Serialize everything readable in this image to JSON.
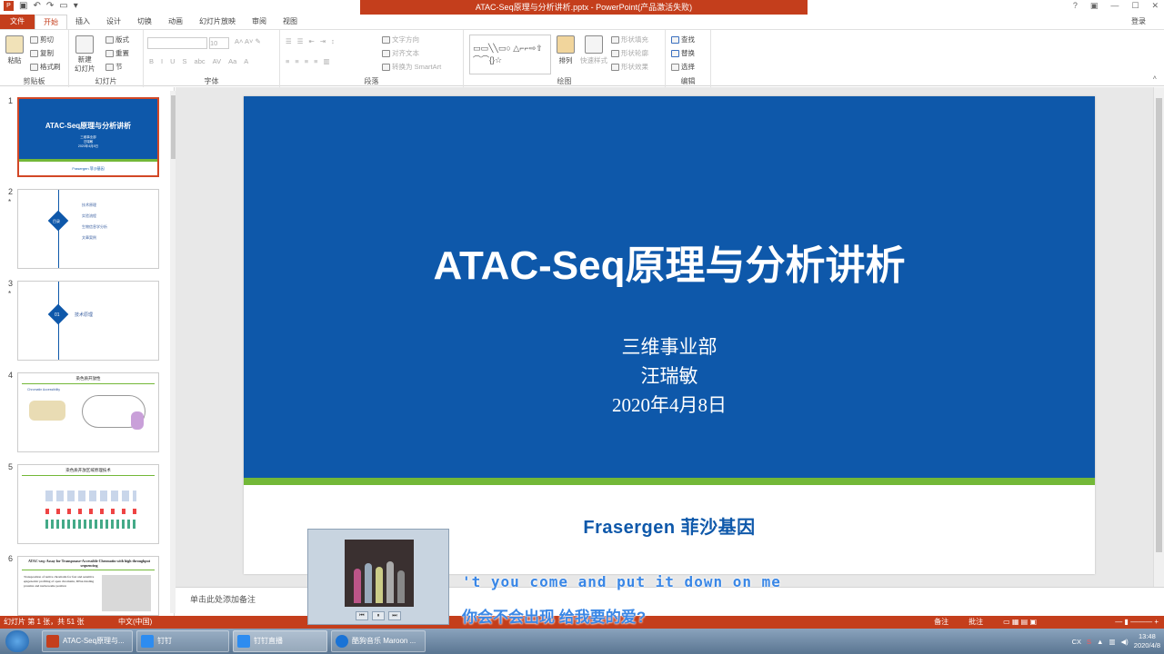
{
  "window": {
    "title": "ATAC-Seq原理与分析讲析.pptx - PowerPoint(产品激活失败)",
    "help": "?",
    "login": "登录"
  },
  "tabs": [
    "文件",
    "开始",
    "插入",
    "设计",
    "切换",
    "动画",
    "幻灯片放映",
    "审阅",
    "视图"
  ],
  "ribbon": {
    "clipboard": {
      "label": "剪贴板",
      "paste": "粘贴",
      "cut": "剪切",
      "copy": "复制",
      "format_painter": "格式刷"
    },
    "slides": {
      "label": "幻灯片",
      "new_slide": "新建\n幻灯片",
      "layout": "版式",
      "reset": "重置",
      "section": "节"
    },
    "font": {
      "label": "字体",
      "size": "10"
    },
    "paragraph": {
      "label": "段落",
      "text_direction": "文字方向",
      "align_text": "对齐文本",
      "smartart": "转换为 SmartArt"
    },
    "drawing": {
      "label": "绘图",
      "arrange": "排列",
      "quick_styles": "快速样式",
      "shape_fill": "形状填充",
      "shape_outline": "形状轮廓",
      "shape_effects": "形状效果"
    },
    "editing": {
      "label": "编辑",
      "find": "查找",
      "replace": "替换",
      "select": "选择"
    }
  },
  "thumbnails": [
    {
      "num": "1",
      "title": "ATAC-Seq原理与分析讲析",
      "lines": [
        "三维事业部",
        "汪瑞敏",
        "2020年4月8日"
      ],
      "logo": "Frasergen 菲沙基因"
    },
    {
      "num": "2",
      "star": "*",
      "heading": "目录",
      "items": [
        "技术原理",
        "实验流程",
        "生物信息学分析",
        "文章案例"
      ]
    },
    {
      "num": "3",
      "star": "*",
      "badge": "01",
      "heading": "技术原理"
    },
    {
      "num": "4",
      "heading": "染色质开放性",
      "sub": "Chromatin Accessibility"
    },
    {
      "num": "5",
      "heading": "染色质开放区域原理技术"
    },
    {
      "num": "6",
      "heading": "ATAC-seq: Assay for Transposase-Accessible Chromatin with high throughput sequencing",
      "body": "Transposition of native chromatin for fast and sensitive epigenomic profiling of open chromatin, DNA-binding proteins and nucleosome position"
    }
  ],
  "slide": {
    "title": "ATAC-Seq原理与分析讲析",
    "dept": "三维事业部",
    "author": "汪瑞敏",
    "date": "2020年4月8日",
    "logo": "Frasergen 菲沙基因"
  },
  "notes_placeholder": "单击此处添加备注",
  "status": {
    "slide_info": "幻灯片 第 1 张，共 51 张",
    "language": "中文(中国)",
    "notes": "备注",
    "comments": "批注"
  },
  "taskbar": {
    "tasks": [
      "ATAC-Seq原理与...",
      "钉钉",
      "钉钉直播",
      "酷狗音乐 Maroon ..."
    ],
    "ime": "CX",
    "time": "13:48",
    "date": "2020/4/8"
  },
  "lyrics": {
    "line1": "'t you come and put it down on me",
    "line2": "你会不会出现 给我要的爱?"
  },
  "colors": {
    "accent": "#c43e1c",
    "slide_blue": "#0e58aa",
    "slide_green": "#73b838",
    "lyric": "#3a87e6"
  }
}
